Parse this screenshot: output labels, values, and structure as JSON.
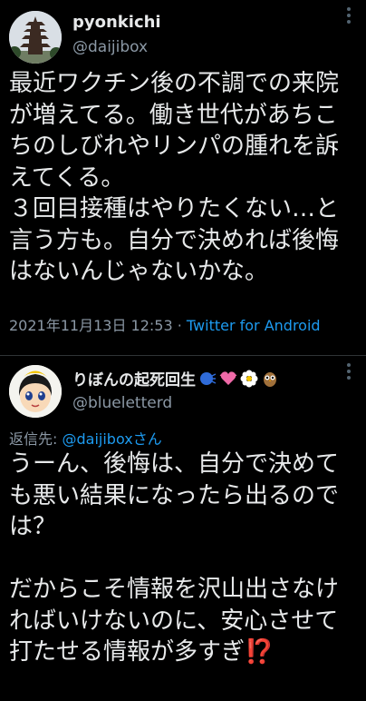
{
  "tweet1": {
    "display_name": "pyonkichi",
    "handle": "@daijibox",
    "text": "最近ワクチン後の不調での来院が増えてる。働き世代があちこちのしびれやリンパの腫れを訴えてくる。\n３回目接種はやりたくない…と言う方も。自分で決めれば後悔はないんじゃないかな。",
    "timestamp": "2021年11月13日 12:53",
    "separator": " · ",
    "via": "Twitter for Android",
    "avatar_icon": "pagoda-avatar-icon"
  },
  "tweet2": {
    "display_name": "りぼんの起死回生",
    "handle": "@blueletterd",
    "reply_prefix": "返信先: ",
    "reply_mention": "@daijiboxさん",
    "text": "うーん、後悔は、自分で決めても悪い結果になったら出るのでは？\n\nだからこそ情報を沢山出さなければいけないのに、安心させて打たせる情報が多すぎ⁉️",
    "avatar_icon": "cartoon-girl-avatar-icon",
    "name_emojis": [
      "speaking-head-emoji",
      "heart-emoji",
      "flower-emoji",
      "owl-emoji"
    ]
  },
  "colors": {
    "background": "#000000",
    "text": "#e7e9ea",
    "secondary": "#8b98a5",
    "link": "#1d9bf0",
    "divider": "#2f3336"
  }
}
